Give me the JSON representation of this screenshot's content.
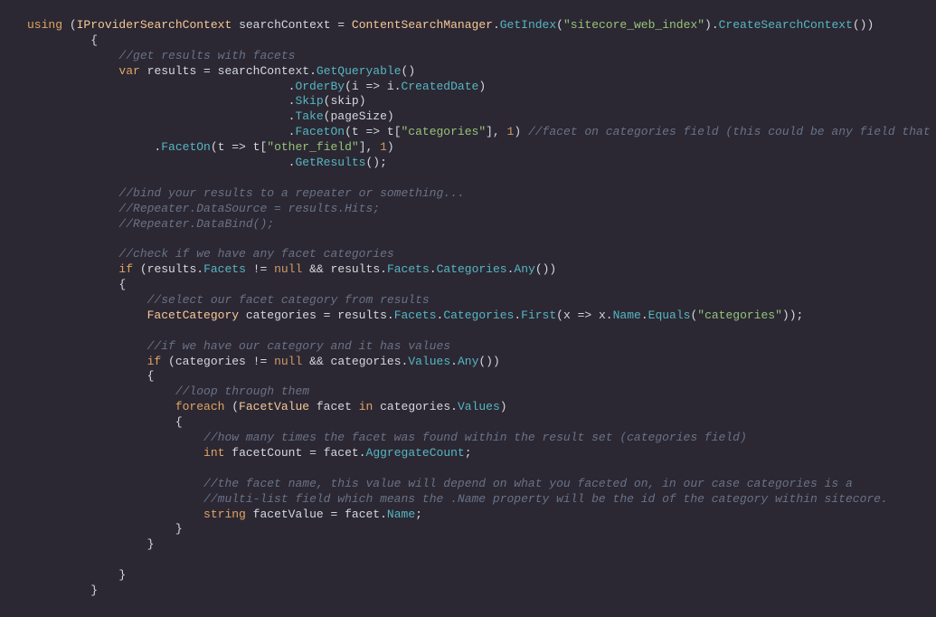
{
  "code": {
    "line1": {
      "using": "using",
      "type": "IProviderSearchContext",
      "var": "searchContext",
      "class": "ContentSearchManager",
      "method1": "GetIndex",
      "str": "\"sitecore_web_index\"",
      "method2": "CreateSearchContext"
    },
    "comment1": "//get results with facets",
    "line2": {
      "var_kw": "var",
      "results": "results",
      "searchContext": "searchContext",
      "method": "GetQueryable"
    },
    "orderby": {
      "method": "OrderBy",
      "lambda": "i => i",
      "prop": "CreatedDate"
    },
    "skip": {
      "method": "Skip",
      "arg": "skip"
    },
    "take": {
      "method": "Take",
      "arg": "pageSize"
    },
    "faceton1": {
      "method": "FacetOn",
      "lambda": "t => t",
      "str": "\"categories\"",
      "num": "1",
      "comment": "//facet on categories field (this could be any field that you wish to facet on)."
    },
    "faceton2": {
      "method": "FacetOn",
      "lambda": "t => t",
      "str": "\"other_field\"",
      "num": "1"
    },
    "getresults": {
      "method": "GetResults"
    },
    "comment2": "//bind your results to a repeater or something...",
    "comment3": "//Repeater.DataSource = results.Hits;",
    "comment4": "//Repeater.DataBind();",
    "comment5": "//check if we have any facet categories",
    "ifcheck": {
      "if": "if",
      "results": "results",
      "facets": "Facets",
      "null": "null",
      "cats": "Categories",
      "any": "Any"
    },
    "comment6": "//select our facet category from results",
    "facetcat": {
      "type": "FacetCategory",
      "var": "categories",
      "results": "results",
      "facets": "Facets",
      "cats": "Categories",
      "first": "First",
      "lambda": "x => x",
      "name": "Name",
      "equals": "Equals",
      "str": "\"categories\""
    },
    "comment7": "//if we have our category and it has values",
    "ifcheck2": {
      "if": "if",
      "categories": "categories",
      "null": "null",
      "values": "Values",
      "any": "Any"
    },
    "comment8": "//loop through them",
    "foreach": {
      "foreach": "foreach",
      "type": "FacetValue",
      "var": "facet",
      "in": "in",
      "categories": "categories",
      "values": "Values"
    },
    "comment9": "//how many times the facet was found within the result set (categories field)",
    "facetcount": {
      "type": "int",
      "var": "facetCount",
      "facet": "facet",
      "prop": "AggregateCount"
    },
    "comment10": "//the facet name, this value will depend on what you faceted on, in our case categories is a",
    "comment11": "//multi-list field which means the .Name property will be the id of the category within sitecore.",
    "facetvalue": {
      "type": "string",
      "var": "facetValue",
      "facet": "facet",
      "prop": "Name"
    }
  }
}
